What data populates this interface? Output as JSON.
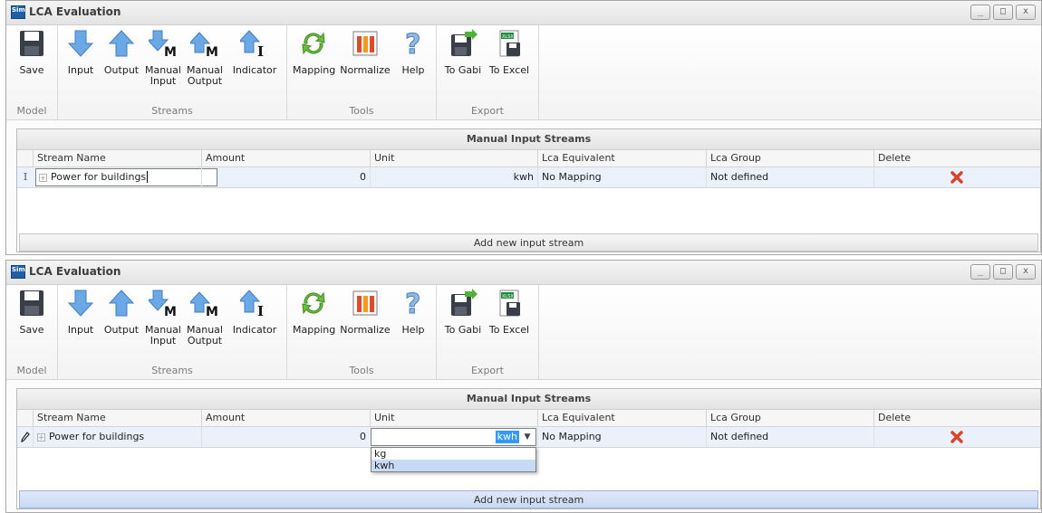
{
  "windows": [
    {
      "title": "LCA Evaluation",
      "app_icon_text": "Sim",
      "ribbon": {
        "groups": [
          "Model",
          "Streams",
          "Tools",
          "Export"
        ],
        "buttons": {
          "save": "Save",
          "input": "Input",
          "output": "Output",
          "manual_input": [
            "Manual",
            "Input"
          ],
          "manual_output": [
            "Manual",
            "Output"
          ],
          "indicator": "Indicator",
          "mapping": "Mapping",
          "normalize": "Normalize",
          "help": "Help",
          "to_gabi": "To Gabi",
          "to_excel": "To Excel"
        }
      },
      "grid": {
        "caption": "Manual Input Streams",
        "columns": [
          "Stream Name",
          "Amount",
          "Unit",
          "Lca Equivalent",
          "Lca Group",
          "Delete"
        ],
        "row": {
          "indicator": "I",
          "stream_name": "Power for buildings",
          "amount": "0",
          "unit": "kwh",
          "lca_equivalent": "No Mapping",
          "lca_group": "Not defined"
        },
        "add_button": "Add new input stream"
      }
    },
    {
      "title": "LCA Evaluation",
      "app_icon_text": "Sim",
      "ribbon": {
        "groups": [
          "Model",
          "Streams",
          "Tools",
          "Export"
        ],
        "buttons": {
          "save": "Save",
          "input": "Input",
          "output": "Output",
          "manual_input": [
            "Manual",
            "Input"
          ],
          "manual_output": [
            "Manual",
            "Output"
          ],
          "indicator": "Indicator",
          "mapping": "Mapping",
          "normalize": "Normalize",
          "help": "Help",
          "to_gabi": "To Gabi",
          "to_excel": "To Excel"
        }
      },
      "grid": {
        "caption": "Manual Input Streams",
        "columns": [
          "Stream Name",
          "Amount",
          "Unit",
          "Lca Equivalent",
          "Lca Group",
          "Delete"
        ],
        "row": {
          "stream_name": "Power for buildings",
          "amount": "0",
          "unit": "kwh",
          "lca_equivalent": "No Mapping",
          "lca_group": "Not defined"
        },
        "unit_options": [
          "kg",
          "kwh"
        ],
        "add_button": "Add new input stream"
      }
    }
  ],
  "icons": {
    "accent_blue": "#4a90d9",
    "arrow_light_blue": "#6aa8e6",
    "delete_red": "#d9442c",
    "icon_letter": "#111111"
  }
}
